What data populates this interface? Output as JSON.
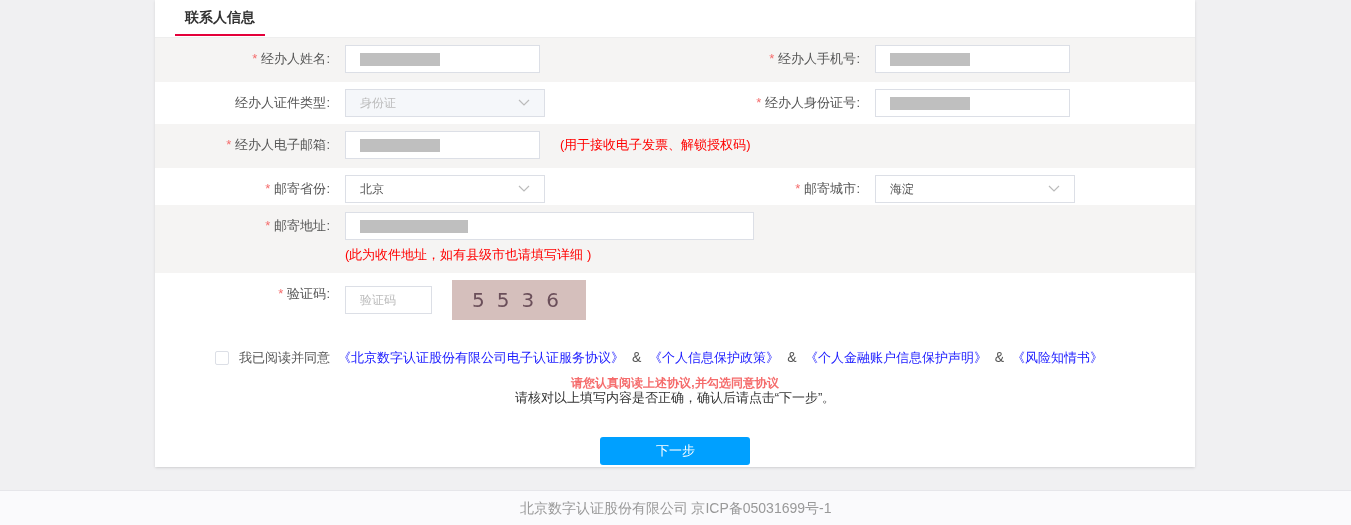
{
  "tabs": [
    {
      "label": "联系人信息",
      "selected": true
    }
  ],
  "rows": [
    {
      "fields": [
        {
          "marker": "*",
          "label": "经办人姓名:",
          "kind": "input",
          "redacted": true
        },
        {
          "marker": "*",
          "label": "经办人手机号:",
          "kind": "input",
          "redacted": true
        }
      ]
    },
    {
      "fields": [
        {
          "label": "经办人证件类型:",
          "kind": "select",
          "value": "身份证",
          "disabled": true
        },
        {
          "marker": "*",
          "label": "经办人身份证号:",
          "kind": "input",
          "redacted": true
        }
      ]
    },
    {
      "fields": [
        {
          "marker": "*",
          "label": "经办人电子邮箱:",
          "kind": "input",
          "redacted": true,
          "note": "(用于接收电子发票、解锁授权码)"
        }
      ]
    },
    {
      "fields": [
        {
          "marker": "*",
          "label": "邮寄省份:",
          "kind": "select",
          "value": "北京",
          "disabled": false
        },
        {
          "marker": "*",
          "label": "邮寄城市:",
          "kind": "select",
          "value": "海淀",
          "disabled": false
        }
      ]
    },
    {
      "fields": [
        {
          "marker": "*",
          "label": "邮寄地址:",
          "kind": "wide",
          "redacted": true,
          "note": "(此为收件地址，如有县级市也请填写详细 )"
        }
      ]
    },
    {
      "fields": [
        {
          "marker": "*",
          "label": "验证码:",
          "kind": "captcha",
          "placeholder": "验证码",
          "captcha": "5536"
        }
      ]
    }
  ],
  "agreement": {
    "checked": false,
    "parts": [
      {
        "kind": "text",
        "text": "我已阅读并同意"
      },
      {
        "kind": "link",
        "text": "《北京数字认证股份有限公司电子认证服务协议》"
      },
      {
        "kind": "sep",
        "text": "&"
      },
      {
        "kind": "link",
        "text": "《个人信息保护政策》"
      },
      {
        "kind": "sep",
        "text": "&"
      },
      {
        "kind": "link",
        "text": "《个人金融账户信息保护声明》"
      },
      {
        "kind": "sep",
        "text": "&"
      },
      {
        "kind": "link",
        "text": "《风险知情书》"
      }
    ]
  },
  "warning": "请您认真阅读上述协议,并勾选同意协议",
  "instruction": "请核对以上填写内容是否正确，确认后请点击“下一步”。",
  "next_button": "下一步",
  "footer": "北京数字认证股份有限公司 京ICP备05031699号-1"
}
